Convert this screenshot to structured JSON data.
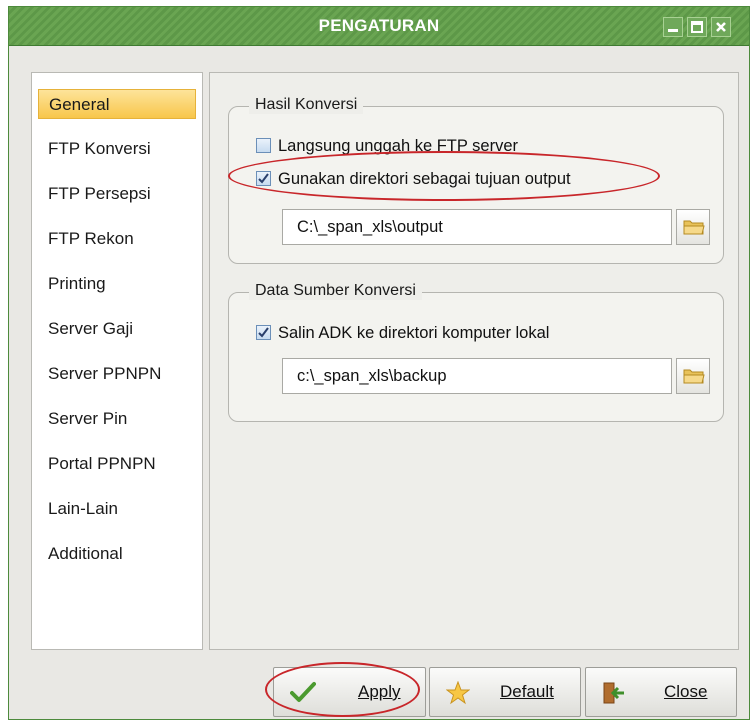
{
  "window": {
    "title": "PENGATURAN",
    "controls": [
      "minimize",
      "maximize",
      "close"
    ],
    "accent_color": "#5d9848"
  },
  "sidebar": {
    "items": [
      {
        "label": "General",
        "active": true
      },
      {
        "label": "FTP Konversi",
        "active": false
      },
      {
        "label": "FTP Persepsi",
        "active": false
      },
      {
        "label": "FTP Rekon",
        "active": false
      },
      {
        "label": "Printing",
        "active": false
      },
      {
        "label": "Server Gaji",
        "active": false
      },
      {
        "label": "Server PPNPN",
        "active": false
      },
      {
        "label": "Server Pin",
        "active": false
      },
      {
        "label": "Portal PPNPN",
        "active": false
      },
      {
        "label": "Lain-Lain",
        "active": false
      },
      {
        "label": "Additional",
        "active": false
      }
    ]
  },
  "hasil_konversi": {
    "legend": "Hasil Konversi",
    "upload_ftp": {
      "label": "Langsung unggah ke FTP server",
      "checked": false
    },
    "use_directory": {
      "label": "Gunakan direktori sebagai tujuan output",
      "checked": true
    },
    "output_path": "C:\\_span_xls\\output"
  },
  "data_sumber": {
    "legend": "Data Sumber Konversi",
    "copy_adk": {
      "label": "Salin ADK ke direktori komputer lokal",
      "checked": true
    },
    "backup_path": "c:\\_span_xls\\backup"
  },
  "buttons": {
    "apply": "Apply",
    "default": "Default",
    "close": "Close"
  },
  "icons": {
    "folder": "folder-open-icon",
    "apply": "checkmark-icon",
    "default": "star-icon",
    "close": "exit-door-icon"
  },
  "colors": {
    "annotation": "#c8262a",
    "active_item": "#f8c64b"
  }
}
